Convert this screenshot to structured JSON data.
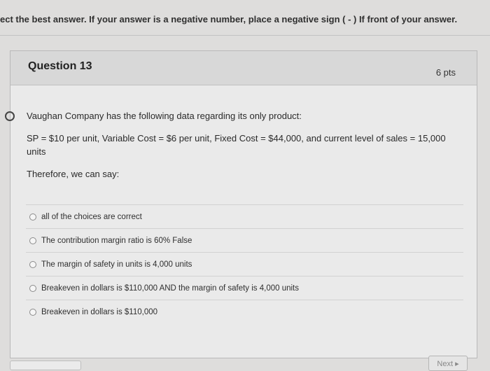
{
  "instruction": "ect the best answer. If your answer is a negative number, place a negative sign ( - ) If front of your answer.",
  "question": {
    "title": "Question 13",
    "points": "6 pts",
    "text_1": "Vaughan Company has the following data regarding its only product:",
    "text_2": "SP = $10 per unit, Variable Cost = $6 per unit, Fixed Cost = $44,000, and current level of sales = 15,000 units",
    "text_3": "Therefore, we can say:"
  },
  "answers": [
    {
      "label": "all of the choices are correct"
    },
    {
      "label": "The contribution margin ratio is 60% False"
    },
    {
      "label": "The margin of safety in units is 4,000 units"
    },
    {
      "label": "Breakeven in dollars is $110,000 AND the margin of safety is 4,000 units"
    },
    {
      "label": "Breakeven in dollars is $110,000"
    }
  ],
  "footer": {
    "next_label": "Next ▸"
  }
}
